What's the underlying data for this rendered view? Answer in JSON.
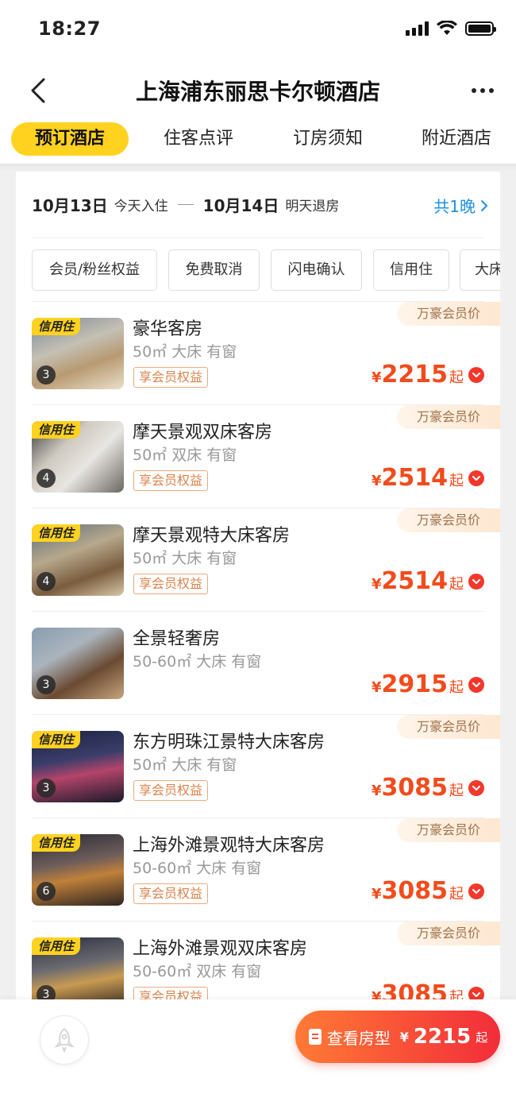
{
  "status_bar": {
    "time": "18:27"
  },
  "nav": {
    "title": "上海浦东丽思卡尔顿酒店"
  },
  "tabs": [
    "预订酒店",
    "住客点评",
    "订房须知",
    "附近酒店"
  ],
  "dates": {
    "checkin_date": "10月13日",
    "checkin_label": "今天入住",
    "checkout_date": "10月14日",
    "checkout_label": "明天退房",
    "nights": "共1晚"
  },
  "filters": [
    "会员/粉丝权益",
    "免费取消",
    "闪电确认",
    "信用住",
    "大床"
  ],
  "labels": {
    "credit": "信用住",
    "member_price": "万豪会员价",
    "perk": "享会员权益",
    "currency": "¥",
    "from": "起"
  },
  "rooms": [
    {
      "name": "豪华客房",
      "info": "50㎡ 大床 有窗",
      "photos": "3",
      "price": "2215",
      "credit": true,
      "member": true,
      "perk": true
    },
    {
      "name": "摩天景观双床客房",
      "info": "50㎡ 双床 有窗",
      "photos": "4",
      "price": "2514",
      "credit": true,
      "member": true,
      "perk": true
    },
    {
      "name": "摩天景观特大床客房",
      "info": "50㎡ 大床 有窗",
      "photos": "4",
      "price": "2514",
      "credit": true,
      "member": true,
      "perk": true
    },
    {
      "name": "全景轻奢房",
      "info": "50-60㎡ 大床 有窗",
      "photos": "3",
      "price": "2915",
      "credit": false,
      "member": false,
      "perk": false
    },
    {
      "name": "东方明珠江景特大床客房",
      "info": "50㎡ 大床 有窗",
      "photos": "3",
      "price": "3085",
      "credit": true,
      "member": true,
      "perk": true
    },
    {
      "name": "上海外滩景观特大床客房",
      "info": "50-60㎡ 大床 有窗",
      "photos": "6",
      "price": "3085",
      "credit": true,
      "member": true,
      "perk": true
    },
    {
      "name": "上海外滩景观双床客房",
      "info": "50-60㎡ 双床 有窗",
      "photos": "3",
      "price": "3085",
      "credit": true,
      "member": true,
      "perk": true
    }
  ],
  "bottom": {
    "cta_label": "查看房型",
    "currency": "¥",
    "cta_price": "2215",
    "from": "起"
  },
  "colors": {
    "accent_yellow": "#ffd21f",
    "price_red": "#f24b1c",
    "link_blue": "#1e90e6"
  }
}
